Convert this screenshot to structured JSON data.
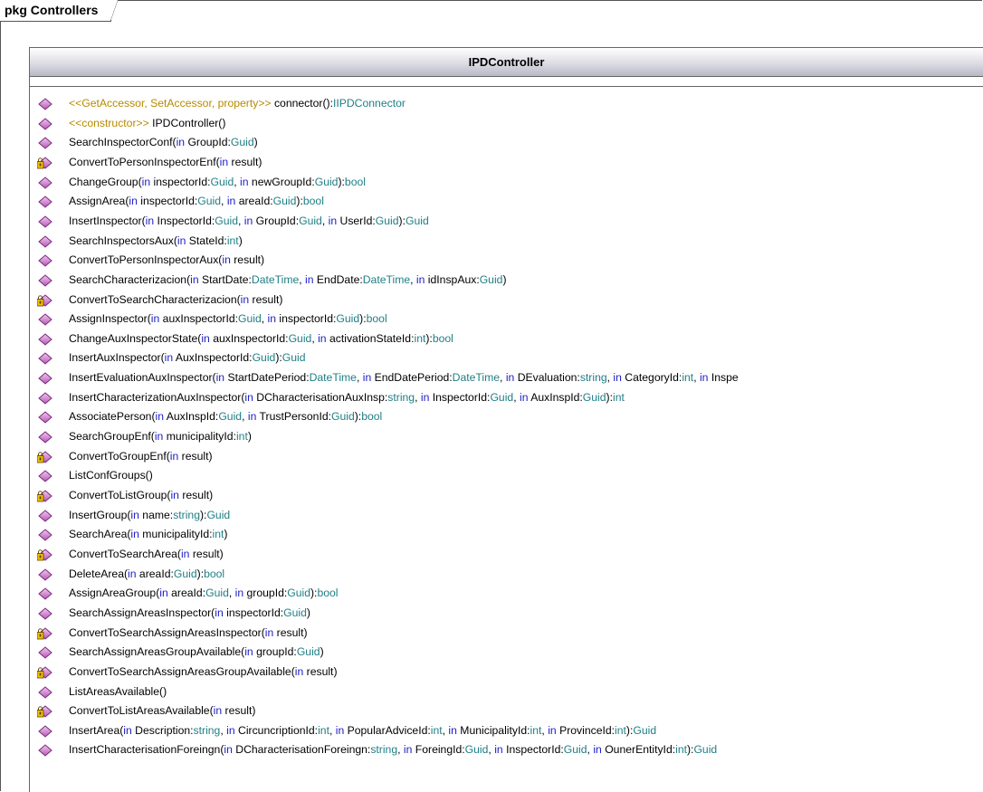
{
  "package": {
    "label": "pkg Controllers"
  },
  "class": {
    "name": "IPDController"
  },
  "operations": [
    {
      "private": false,
      "parts": [
        [
          "st",
          "<<GetAccessor, SetAccessor, property>>"
        ],
        [
          "n",
          " connector():"
        ],
        [
          "ty",
          "IIPDConnector"
        ]
      ]
    },
    {
      "private": false,
      "parts": [
        [
          "st",
          "<<constructor>>"
        ],
        [
          "n",
          " IPDController()"
        ]
      ]
    },
    {
      "private": false,
      "parts": [
        [
          "n",
          "SearchInspectorConf("
        ],
        [
          "kw",
          "in"
        ],
        [
          "n",
          " GroupId:"
        ],
        [
          "ty",
          "Guid"
        ],
        [
          "n",
          ")"
        ]
      ]
    },
    {
      "private": true,
      "parts": [
        [
          "n",
          "ConvertToPersonInspectorEnf("
        ],
        [
          "kw",
          "in"
        ],
        [
          "n",
          " result)"
        ]
      ]
    },
    {
      "private": false,
      "parts": [
        [
          "n",
          "ChangeGroup("
        ],
        [
          "kw",
          "in"
        ],
        [
          "n",
          " inspectorId:"
        ],
        [
          "ty",
          "Guid"
        ],
        [
          "n",
          ", "
        ],
        [
          "kw",
          "in"
        ],
        [
          "n",
          " newGroupId:"
        ],
        [
          "ty",
          "Guid"
        ],
        [
          "n",
          "):"
        ],
        [
          "ty",
          "bool"
        ]
      ]
    },
    {
      "private": false,
      "parts": [
        [
          "n",
          "AssignArea("
        ],
        [
          "kw",
          "in"
        ],
        [
          "n",
          " inspectorId:"
        ],
        [
          "ty",
          "Guid"
        ],
        [
          "n",
          ", "
        ],
        [
          "kw",
          "in"
        ],
        [
          "n",
          " areaId:"
        ],
        [
          "ty",
          "Guid"
        ],
        [
          "n",
          "):"
        ],
        [
          "ty",
          "bool"
        ]
      ]
    },
    {
      "private": false,
      "parts": [
        [
          "n",
          "InsertInspector("
        ],
        [
          "kw",
          "in"
        ],
        [
          "n",
          " InspectorId:"
        ],
        [
          "ty",
          "Guid"
        ],
        [
          "n",
          ", "
        ],
        [
          "kw",
          "in"
        ],
        [
          "n",
          " GroupId:"
        ],
        [
          "ty",
          "Guid"
        ],
        [
          "n",
          ", "
        ],
        [
          "kw",
          "in"
        ],
        [
          "n",
          " UserId:"
        ],
        [
          "ty",
          "Guid"
        ],
        [
          "n",
          "):"
        ],
        [
          "ty",
          "Guid"
        ]
      ]
    },
    {
      "private": false,
      "parts": [
        [
          "n",
          "SearchInspectorsAux("
        ],
        [
          "kw",
          "in"
        ],
        [
          "n",
          " StateId:"
        ],
        [
          "ty",
          "int"
        ],
        [
          "n",
          ")"
        ]
      ]
    },
    {
      "private": false,
      "parts": [
        [
          "n",
          "ConvertToPersonInspectorAux("
        ],
        [
          "kw",
          "in"
        ],
        [
          "n",
          " result)"
        ]
      ]
    },
    {
      "private": false,
      "parts": [
        [
          "n",
          "SearchCharacterizacion("
        ],
        [
          "kw",
          "in"
        ],
        [
          "n",
          " StartDate:"
        ],
        [
          "ty",
          "DateTime"
        ],
        [
          "n",
          ", "
        ],
        [
          "kw",
          "in"
        ],
        [
          "n",
          " EndDate:"
        ],
        [
          "ty",
          "DateTime"
        ],
        [
          "n",
          ", "
        ],
        [
          "kw",
          "in"
        ],
        [
          "n",
          " idInspAux:"
        ],
        [
          "ty",
          "Guid"
        ],
        [
          "n",
          ")"
        ]
      ]
    },
    {
      "private": true,
      "parts": [
        [
          "n",
          "ConvertToSearchCharacterizacion("
        ],
        [
          "kw",
          "in"
        ],
        [
          "n",
          " result)"
        ]
      ]
    },
    {
      "private": false,
      "parts": [
        [
          "n",
          "AssignInspector("
        ],
        [
          "kw",
          "in"
        ],
        [
          "n",
          " auxInspectorId:"
        ],
        [
          "ty",
          "Guid"
        ],
        [
          "n",
          ", "
        ],
        [
          "kw",
          "in"
        ],
        [
          "n",
          " inspectorId:"
        ],
        [
          "ty",
          "Guid"
        ],
        [
          "n",
          "):"
        ],
        [
          "ty",
          "bool"
        ]
      ]
    },
    {
      "private": false,
      "parts": [
        [
          "n",
          "ChangeAuxInspectorState("
        ],
        [
          "kw",
          "in"
        ],
        [
          "n",
          " auxInspectorId:"
        ],
        [
          "ty",
          "Guid"
        ],
        [
          "n",
          ", "
        ],
        [
          "kw",
          "in"
        ],
        [
          "n",
          " activationStateId:"
        ],
        [
          "ty",
          "int"
        ],
        [
          "n",
          "):"
        ],
        [
          "ty",
          "bool"
        ]
      ]
    },
    {
      "private": false,
      "parts": [
        [
          "n",
          "InsertAuxInspector("
        ],
        [
          "kw",
          "in"
        ],
        [
          "n",
          " AuxInspectorId:"
        ],
        [
          "ty",
          "Guid"
        ],
        [
          "n",
          "):"
        ],
        [
          "ty",
          "Guid"
        ]
      ]
    },
    {
      "private": false,
      "parts": [
        [
          "n",
          "InsertEvaluationAuxInspector("
        ],
        [
          "kw",
          "in"
        ],
        [
          "n",
          " StartDatePeriod:"
        ],
        [
          "ty",
          "DateTime"
        ],
        [
          "n",
          ", "
        ],
        [
          "kw",
          "in"
        ],
        [
          "n",
          " EndDatePeriod:"
        ],
        [
          "ty",
          "DateTime"
        ],
        [
          "n",
          ", "
        ],
        [
          "kw",
          "in"
        ],
        [
          "n",
          " DEvaluation:"
        ],
        [
          "ty",
          "string"
        ],
        [
          "n",
          ", "
        ],
        [
          "kw",
          "in"
        ],
        [
          "n",
          " CategoryId:"
        ],
        [
          "ty",
          "int"
        ],
        [
          "n",
          ", "
        ],
        [
          "kw",
          "in"
        ],
        [
          "n",
          " Inspe"
        ]
      ]
    },
    {
      "private": false,
      "parts": [
        [
          "n",
          "InsertCharacterizationAuxInspector("
        ],
        [
          "kw",
          "in"
        ],
        [
          "n",
          " DCharacterisationAuxInsp:"
        ],
        [
          "ty",
          "string"
        ],
        [
          "n",
          ", "
        ],
        [
          "kw",
          "in"
        ],
        [
          "n",
          " InspectorId:"
        ],
        [
          "ty",
          "Guid"
        ],
        [
          "n",
          ", "
        ],
        [
          "kw",
          "in"
        ],
        [
          "n",
          " AuxInspId:"
        ],
        [
          "ty",
          "Guid"
        ],
        [
          "n",
          "):"
        ],
        [
          "ty",
          "int"
        ]
      ]
    },
    {
      "private": false,
      "parts": [
        [
          "n",
          "AssociatePerson("
        ],
        [
          "kw",
          "in"
        ],
        [
          "n",
          " AuxInspId:"
        ],
        [
          "ty",
          "Guid"
        ],
        [
          "n",
          ", "
        ],
        [
          "kw",
          "in"
        ],
        [
          "n",
          " TrustPersonId:"
        ],
        [
          "ty",
          "Guid"
        ],
        [
          "n",
          "):"
        ],
        [
          "ty",
          "bool"
        ]
      ]
    },
    {
      "private": false,
      "parts": [
        [
          "n",
          "SearchGroupEnf("
        ],
        [
          "kw",
          "in"
        ],
        [
          "n",
          " municipalityId:"
        ],
        [
          "ty",
          "int"
        ],
        [
          "n",
          ")"
        ]
      ]
    },
    {
      "private": true,
      "parts": [
        [
          "n",
          "ConvertToGroupEnf("
        ],
        [
          "kw",
          "in"
        ],
        [
          "n",
          " result)"
        ]
      ]
    },
    {
      "private": false,
      "parts": [
        [
          "n",
          "ListConfGroups()"
        ]
      ]
    },
    {
      "private": true,
      "parts": [
        [
          "n",
          "ConvertToListGroup("
        ],
        [
          "kw",
          "in"
        ],
        [
          "n",
          " result)"
        ]
      ]
    },
    {
      "private": false,
      "parts": [
        [
          "n",
          "InsertGroup("
        ],
        [
          "kw",
          "in"
        ],
        [
          "n",
          " name:"
        ],
        [
          "ty",
          "string"
        ],
        [
          "n",
          "):"
        ],
        [
          "ty",
          "Guid"
        ]
      ]
    },
    {
      "private": false,
      "parts": [
        [
          "n",
          "SearchArea("
        ],
        [
          "kw",
          "in"
        ],
        [
          "n",
          " municipalityId:"
        ],
        [
          "ty",
          "int"
        ],
        [
          "n",
          ")"
        ]
      ]
    },
    {
      "private": true,
      "parts": [
        [
          "n",
          "ConvertToSearchArea("
        ],
        [
          "kw",
          "in"
        ],
        [
          "n",
          " result)"
        ]
      ]
    },
    {
      "private": false,
      "parts": [
        [
          "n",
          "DeleteArea("
        ],
        [
          "kw",
          "in"
        ],
        [
          "n",
          " areaId:"
        ],
        [
          "ty",
          "Guid"
        ],
        [
          "n",
          "):"
        ],
        [
          "ty",
          "bool"
        ]
      ]
    },
    {
      "private": false,
      "parts": [
        [
          "n",
          "AssignAreaGroup("
        ],
        [
          "kw",
          "in"
        ],
        [
          "n",
          " areaId:"
        ],
        [
          "ty",
          "Guid"
        ],
        [
          "n",
          ", "
        ],
        [
          "kw",
          "in"
        ],
        [
          "n",
          " groupId:"
        ],
        [
          "ty",
          "Guid"
        ],
        [
          "n",
          "):"
        ],
        [
          "ty",
          "bool"
        ]
      ]
    },
    {
      "private": false,
      "parts": [
        [
          "n",
          "SearchAssignAreasInspector("
        ],
        [
          "kw",
          "in"
        ],
        [
          "n",
          " inspectorId:"
        ],
        [
          "ty",
          "Guid"
        ],
        [
          "n",
          ")"
        ]
      ]
    },
    {
      "private": true,
      "parts": [
        [
          "n",
          "ConvertToSearchAssignAreasInspector("
        ],
        [
          "kw",
          "in"
        ],
        [
          "n",
          " result)"
        ]
      ]
    },
    {
      "private": false,
      "parts": [
        [
          "n",
          "SearchAssignAreasGroupAvailable("
        ],
        [
          "kw",
          "in"
        ],
        [
          "n",
          " groupId:"
        ],
        [
          "ty",
          "Guid"
        ],
        [
          "n",
          ")"
        ]
      ]
    },
    {
      "private": true,
      "parts": [
        [
          "n",
          "ConvertToSearchAssignAreasGroupAvailable("
        ],
        [
          "kw",
          "in"
        ],
        [
          "n",
          " result)"
        ]
      ]
    },
    {
      "private": false,
      "parts": [
        [
          "n",
          "ListAreasAvailable()"
        ]
      ]
    },
    {
      "private": true,
      "parts": [
        [
          "n",
          "ConvertToListAreasAvailable("
        ],
        [
          "kw",
          "in"
        ],
        [
          "n",
          " result)"
        ]
      ]
    },
    {
      "private": false,
      "parts": [
        [
          "n",
          "InsertArea("
        ],
        [
          "kw",
          "in"
        ],
        [
          "n",
          " Description:"
        ],
        [
          "ty",
          "string"
        ],
        [
          "n",
          ", "
        ],
        [
          "kw",
          "in"
        ],
        [
          "n",
          " CircuncriptionId:"
        ],
        [
          "ty",
          "int"
        ],
        [
          "n",
          ", "
        ],
        [
          "kw",
          "in"
        ],
        [
          "n",
          " PopularAdviceId:"
        ],
        [
          "ty",
          "int"
        ],
        [
          "n",
          ", "
        ],
        [
          "kw",
          "in"
        ],
        [
          "n",
          " MunicipalityId:"
        ],
        [
          "ty",
          "int"
        ],
        [
          "n",
          ", "
        ],
        [
          "kw",
          "in"
        ],
        [
          "n",
          " ProvinceId:"
        ],
        [
          "ty",
          "int"
        ],
        [
          "n",
          "):"
        ],
        [
          "ty",
          "Guid"
        ]
      ]
    },
    {
      "private": false,
      "parts": [
        [
          "n",
          "InsertCharacterisationForeingn("
        ],
        [
          "kw",
          "in"
        ],
        [
          "n",
          " DCharacterisationForeingn:"
        ],
        [
          "ty",
          "string"
        ],
        [
          "n",
          ", "
        ],
        [
          "kw",
          "in"
        ],
        [
          "n",
          " ForeingId:"
        ],
        [
          "ty",
          "Guid"
        ],
        [
          "n",
          ", "
        ],
        [
          "kw",
          "in"
        ],
        [
          "n",
          " InspectorId:"
        ],
        [
          "ty",
          "Guid"
        ],
        [
          "n",
          ", "
        ],
        [
          "kw",
          "in"
        ],
        [
          "n",
          " OunerEntityId:"
        ],
        [
          "ty",
          "int"
        ],
        [
          "n",
          "):"
        ],
        [
          "ty",
          "Guid"
        ]
      ]
    }
  ]
}
